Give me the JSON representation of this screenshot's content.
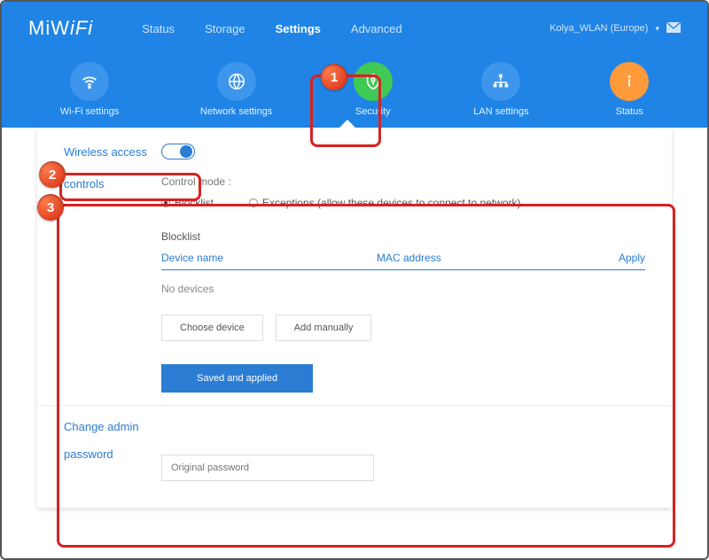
{
  "brand": "MiWiFi",
  "nav": {
    "status": "Status",
    "storage": "Storage",
    "settings": "Settings",
    "advanced": "Advanced"
  },
  "user": "Kolya_WLAN (Europe)",
  "subtabs": {
    "wifi": "Wi-Fi settings",
    "network": "Network settings",
    "security": "Security",
    "lan": "LAN settings",
    "status": "Status"
  },
  "section": {
    "wireless": "Wireless access",
    "controls": "controls",
    "changeadmin": "Change admin",
    "password": "password"
  },
  "control": {
    "mode_label": "Control mode :",
    "blocklist": "Blocklist",
    "exceptions": "Exceptions (allow these devices to connect to network)",
    "heading": "Blocklist",
    "col_device": "Device name",
    "col_mac": "MAC address",
    "col_apply": "Apply",
    "empty": "No devices",
    "choose": "Choose device",
    "add": "Add manually",
    "save": "Saved and applied"
  },
  "pwd_placeholder": "Original password",
  "badges": {
    "b1": "1",
    "b2": "2",
    "b3": "3"
  }
}
